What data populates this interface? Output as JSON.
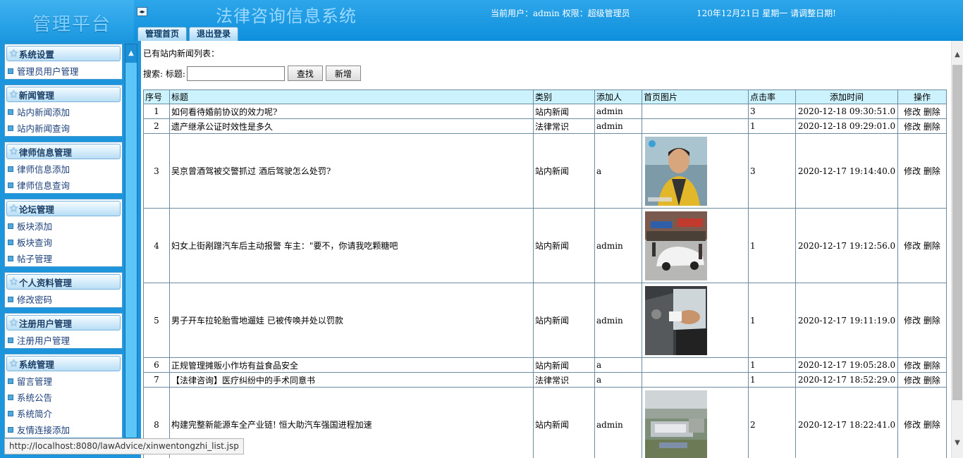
{
  "header": {
    "brand": "管理平台",
    "collapse_icon": "◂▸",
    "system_title": "法律咨询信息系统",
    "current_user": "当前用户：admin 权限：超级管理员",
    "date_info": "120年12月21日 星期一    请调整日期!",
    "tabs": [
      "管理首页",
      "退出登录"
    ]
  },
  "sidebar": {
    "groups": [
      {
        "title": "系统设置",
        "items": [
          "管理员用户管理"
        ]
      },
      {
        "title": "新闻管理",
        "items": [
          "站内新闻添加",
          "站内新闻查询"
        ]
      },
      {
        "title": "律师信息管理",
        "items": [
          "律师信息添加",
          "律师信息查询"
        ]
      },
      {
        "title": "论坛管理",
        "items": [
          "板块添加",
          "板块查询",
          "帖子管理"
        ]
      },
      {
        "title": "个人资料管理",
        "items": [
          "修改密码"
        ]
      },
      {
        "title": "注册用户管理",
        "items": [
          "注册用户管理"
        ]
      },
      {
        "title": "系统管理",
        "items": [
          "留言管理",
          "系统公告",
          "系统简介",
          "友情连接添加"
        ]
      }
    ]
  },
  "main": {
    "caption": "已有站内新闻列表：",
    "search_label": "搜索: 标题:",
    "search_value": "",
    "search_button": "查找",
    "add_button": "新增",
    "columns": [
      "序号",
      "标题",
      "类别",
      "添加人",
      "首页图片",
      "点击率",
      "添加时间",
      "操作"
    ],
    "rows": [
      {
        "no": "1",
        "title": "如何看待婚前协议的效力呢?",
        "category": "站内新闻",
        "author": "admin",
        "image": "",
        "clicks": "3",
        "time": "2020-12-18 09:30:51.0",
        "edit": "修改",
        "delete": "删除"
      },
      {
        "no": "2",
        "title": "遗产继承公证时效性是多久",
        "category": "法律常识",
        "author": "admin",
        "image": "",
        "clicks": "1",
        "time": "2020-12-18 09:29:01.0",
        "edit": "修改",
        "delete": "删除"
      },
      {
        "no": "3",
        "title": "吴京曾酒驾被交警抓过 酒后驾驶怎么处罚?",
        "category": "站内新闻",
        "author": "a",
        "image": "person-photo",
        "clicks": "3",
        "time": "2020-12-17 19:14:40.0",
        "edit": "修改",
        "delete": "删除"
      },
      {
        "no": "4",
        "title": "妇女上街剐蹭汽车后主动报警 车主：\"要不，你请我吃颗糖吧",
        "category": "站内新闻",
        "author": "admin",
        "image": "street-car-photo",
        "clicks": "1",
        "time": "2020-12-17 19:12:56.0",
        "edit": "修改",
        "delete": "删除"
      },
      {
        "no": "5",
        "title": "男子开车拉轮胎雪地遛娃 已被传唤并处以罚款",
        "category": "站内新闻",
        "author": "admin",
        "image": "car-window-photo",
        "clicks": "1",
        "time": "2020-12-17 19:11:19.0",
        "edit": "修改",
        "delete": "删除"
      },
      {
        "no": "6",
        "title": "正规管理摊贩小作坊有益食品安全",
        "category": "站内新闻",
        "author": "a",
        "image": "",
        "clicks": "1",
        "time": "2020-12-17 19:05:28.0",
        "edit": "修改",
        "delete": "删除"
      },
      {
        "no": "7",
        "title": "【法律咨询】医疗纠纷中的手术同意书",
        "category": "法律常识",
        "author": "a",
        "image": "",
        "clicks": "1",
        "time": "2020-12-17 18:52:29.0",
        "edit": "修改",
        "delete": "删除"
      },
      {
        "no": "8",
        "title": "构建完整新能源车全产业链! 恒大助汽车强国进程加速",
        "category": "站内新闻",
        "author": "admin",
        "image": "aerial-factory-photo",
        "clicks": "2",
        "time": "2020-12-17 18:22:41.0",
        "edit": "修改",
        "delete": "删除"
      }
    ]
  },
  "status_url": "http://localhost:8080/lawAdvice/xinwentongzhi_list.jsp",
  "colors": {
    "header": "#1596e0",
    "sidebar": "#1c95dd",
    "table_header": "#ccf2fd",
    "border": "#6c8aa0"
  }
}
